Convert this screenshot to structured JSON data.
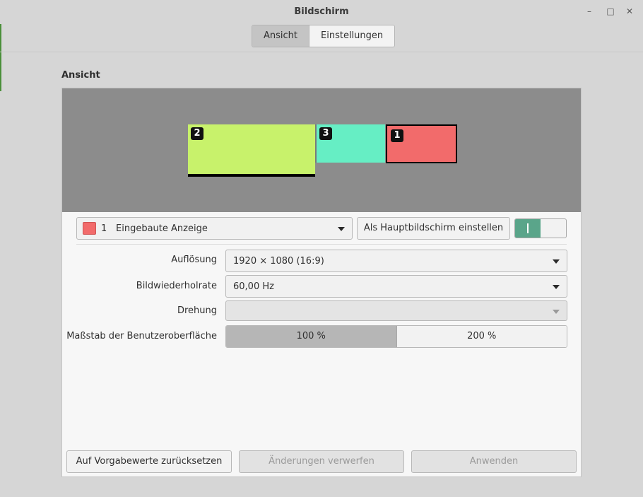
{
  "window": {
    "title": "Bildschirm",
    "minimize_glyph": "–",
    "maximize_glyph": "□",
    "close_glyph": "✕"
  },
  "tabs": [
    {
      "label": "Ansicht",
      "active": true
    },
    {
      "label": "Einstellungen",
      "active": false
    }
  ],
  "section_title": "Ansicht",
  "monitors": [
    {
      "number": "2",
      "color": "#c8f26b",
      "primary": false
    },
    {
      "number": "3",
      "color": "#66eec4",
      "primary": false
    },
    {
      "number": "1",
      "color": "#f26b6b",
      "primary": true
    }
  ],
  "monitor_select": {
    "number": "1",
    "name": "Eingebaute Anzeige",
    "color": "#f26b6b"
  },
  "primary_button": "Als Hauptbildschirm einstellen",
  "enable_toggle": {
    "on": true,
    "on_label": "I"
  },
  "settings": {
    "resolution_label": "Auflösung",
    "resolution_value": "1920 × 1080 (16:9)",
    "refresh_label": "Bildwiederholrate",
    "refresh_value": "60,00 Hz",
    "rotation_label": "Drehung",
    "rotation_value": "",
    "scale_label": "Maßstab der Benutzeroberfläche",
    "scale_options": [
      "100 %",
      "200 %"
    ],
    "scale_selected": "100 %"
  },
  "footer": {
    "reset": "Auf Vorgabewerte zurücksetzen",
    "discard": "Änderungen verwerfen",
    "apply": "Anwenden"
  }
}
